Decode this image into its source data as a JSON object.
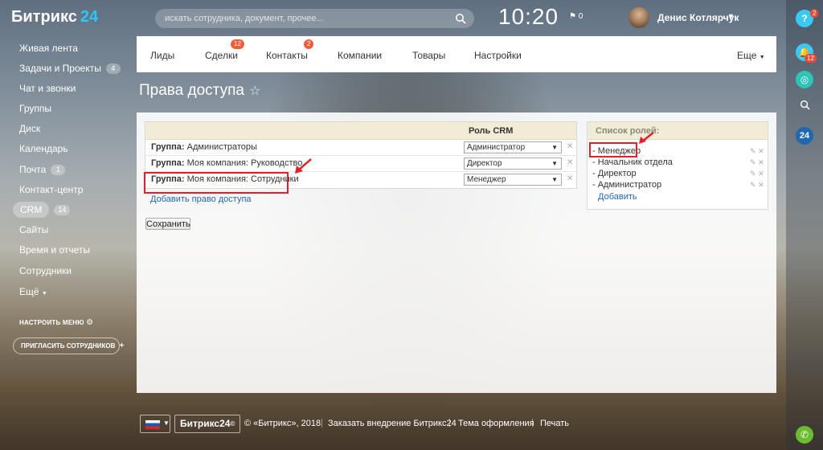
{
  "header": {
    "logo_text": "Битрикс",
    "logo_num": "24",
    "search_placeholder": "искать сотрудника, документ, прочее...",
    "clock": "10:20",
    "flag_count": "0",
    "user_name": "Денис Котлярчук"
  },
  "sidebar": {
    "items": [
      {
        "label": "Живая лента"
      },
      {
        "label": "Задачи и Проекты",
        "badge": "4"
      },
      {
        "label": "Чат и звонки"
      },
      {
        "label": "Группы"
      },
      {
        "label": "Диск"
      },
      {
        "label": "Календарь"
      },
      {
        "label": "Почта",
        "badge": "1"
      },
      {
        "label": "Контакт-центр"
      },
      {
        "label": "CRM",
        "badge": "14"
      },
      {
        "label": "Сайты"
      },
      {
        "label": "Время и отчеты"
      },
      {
        "label": "Сотрудники"
      },
      {
        "label": "Ещё"
      }
    ],
    "configure_menu": "НАСТРОИТЬ МЕНЮ",
    "invite": "ПРИГЛАСИТЬ СОТРУДНИКОВ"
  },
  "rail": {
    "help_badge": "2",
    "notify_badge": "12",
    "b24": "24"
  },
  "tabs": {
    "items": [
      {
        "label": "Лиды"
      },
      {
        "label": "Сделки",
        "count": "12"
      },
      {
        "label": "Контакты",
        "count": "2"
      },
      {
        "label": "Компании"
      },
      {
        "label": "Товары"
      },
      {
        "label": "Настройки"
      }
    ],
    "more": "Еще"
  },
  "page": {
    "title": "Права доступа",
    "star": "☆"
  },
  "access_table": {
    "role_column": "Роль CRM",
    "rows": [
      {
        "prefix": "Группа:",
        "group": "Администраторы",
        "role": "Администратор"
      },
      {
        "prefix": "Группа:",
        "group": "Моя компания: Руководство",
        "role": "Директор"
      },
      {
        "prefix": "Группа:",
        "group": "Моя компания: Сотрудники",
        "role": "Менеджер"
      }
    ],
    "add_link": "Добавить право доступа",
    "save": "Сохранить"
  },
  "roles": {
    "title": "Список ролей:",
    "items": [
      {
        "label": "- Менеджер"
      },
      {
        "label": "- Начальник отдела"
      },
      {
        "label": "- Директор"
      },
      {
        "label": "- Администратор"
      }
    ],
    "add": "Добавить"
  },
  "footer": {
    "brand": "Битрикс24",
    "copyright": "© «Битрикс», 2018",
    "order": "Заказать внедрение Битрикс24",
    "theme": "Тема оформления",
    "print": "Печать"
  },
  "colors": {
    "accent": "#2fc6f6",
    "badge_red": "#ef5e3a",
    "annotation_red": "#e0212a",
    "link": "#2067b0"
  }
}
